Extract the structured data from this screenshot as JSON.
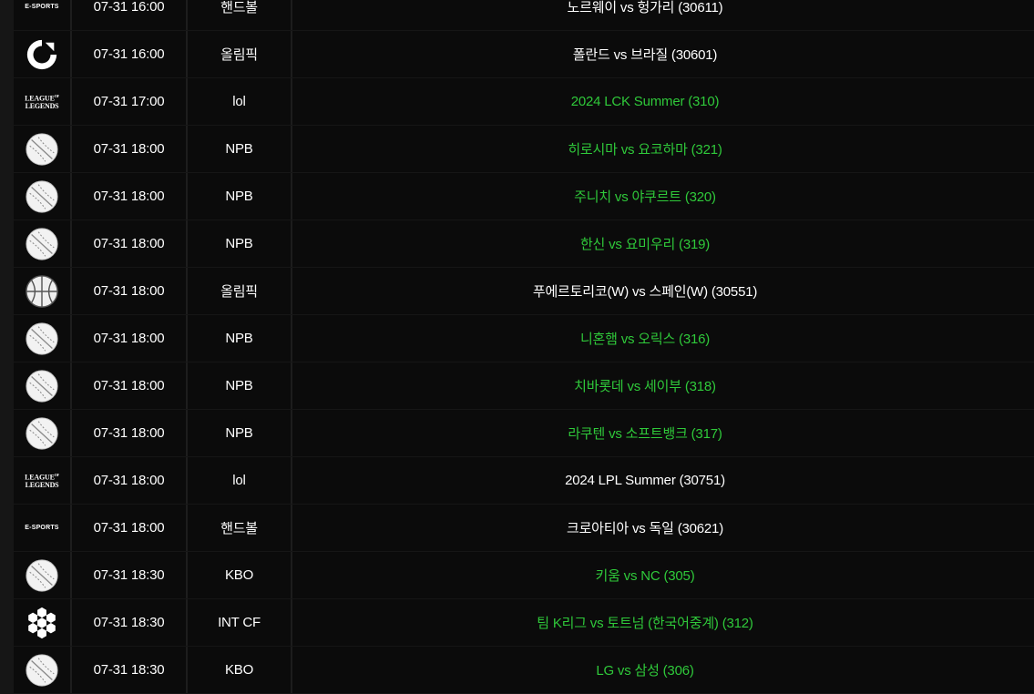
{
  "rows": [
    {
      "sport": "esports",
      "icon": "esports-icon",
      "time": "07-31 16:00",
      "league": "핸드볼",
      "match": "노르웨이 vs 헝가리 (30611)",
      "live": false
    },
    {
      "sport": "olympic",
      "icon": "olympic-icon",
      "time": "07-31 16:00",
      "league": "올림픽",
      "match": "폴란드 vs 브라질 (30601)",
      "live": false
    },
    {
      "sport": "lol",
      "icon": "league-of-legends-icon",
      "time": "07-31 17:00",
      "league": "lol",
      "match": "2024 LCK Summer (310)",
      "live": true
    },
    {
      "sport": "baseball",
      "icon": "baseball-icon",
      "time": "07-31 18:00",
      "league": "NPB",
      "match": "히로시마 vs 요코하마 (321)",
      "live": true
    },
    {
      "sport": "baseball",
      "icon": "baseball-icon",
      "time": "07-31 18:00",
      "league": "NPB",
      "match": "주니치 vs 야쿠르트 (320)",
      "live": true
    },
    {
      "sport": "baseball",
      "icon": "baseball-icon",
      "time": "07-31 18:00",
      "league": "NPB",
      "match": "한신 vs 요미우리 (319)",
      "live": true
    },
    {
      "sport": "basketball",
      "icon": "basketball-icon",
      "time": "07-31 18:00",
      "league": "올림픽",
      "match": "푸에르토리코(W) vs 스페인(W) (30551)",
      "live": false
    },
    {
      "sport": "baseball",
      "icon": "baseball-icon",
      "time": "07-31 18:00",
      "league": "NPB",
      "match": "니혼햄 vs 오릭스 (316)",
      "live": true
    },
    {
      "sport": "baseball",
      "icon": "baseball-icon",
      "time": "07-31 18:00",
      "league": "NPB",
      "match": "치바롯데 vs 세이부 (318)",
      "live": true
    },
    {
      "sport": "baseball",
      "icon": "baseball-icon",
      "time": "07-31 18:00",
      "league": "NPB",
      "match": "라쿠텐 vs 소프트뱅크 (317)",
      "live": true
    },
    {
      "sport": "lol",
      "icon": "league-of-legends-icon",
      "time": "07-31 18:00",
      "league": "lol",
      "match": "2024 LPL Summer (30751)",
      "live": false
    },
    {
      "sport": "esports",
      "icon": "esports-icon",
      "time": "07-31 18:00",
      "league": "핸드볼",
      "match": "크로아티아 vs 독일 (30621)",
      "live": false
    },
    {
      "sport": "baseball",
      "icon": "baseball-icon",
      "time": "07-31 18:30",
      "league": "KBO",
      "match": "키움 vs NC (305)",
      "live": true
    },
    {
      "sport": "soccer",
      "icon": "soccer-icon",
      "time": "07-31 18:30",
      "league": "INT CF",
      "match": "팀 K리그 vs 토트넘 (한국어중계) (312)",
      "live": true
    },
    {
      "sport": "baseball",
      "icon": "baseball-icon",
      "time": "07-31 18:30",
      "league": "KBO",
      "match": "LG vs 삼성 (306)",
      "live": true
    }
  ],
  "logos": {
    "esports_text": "E-SPORTS",
    "lol_line1": "LEAGUE",
    "lol_line2": "LEGENDS",
    "lol_of": "OF"
  },
  "colors": {
    "live_match": "#2fc93a",
    "default_text": "#ffffff",
    "row_bg": "#0b0b0b"
  }
}
